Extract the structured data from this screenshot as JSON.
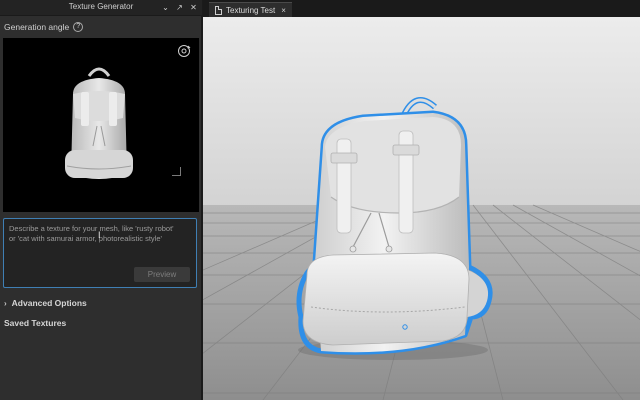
{
  "panel": {
    "title": "Texture Generator",
    "icons": [
      "chevron-down-icon",
      "pin-icon",
      "close-icon"
    ],
    "generation_angle_label": "Generation angle",
    "help_glyph": "?",
    "prompt_placeholder": "Describe a texture for your mesh, like 'rusty robot'\nor 'cat with samurai armor, photorealistic style'",
    "preview_button": "Preview",
    "advanced_options": "Advanced Options",
    "saved_textures": "Saved Textures"
  },
  "tabs": [
    {
      "label": "Texturing Test",
      "close": "×"
    }
  ],
  "colors": {
    "selection_outline": "#2f8fe8",
    "sky": "#d9d9d9",
    "floor": "#9a9a9a",
    "mesh": "#e4e4e4"
  }
}
